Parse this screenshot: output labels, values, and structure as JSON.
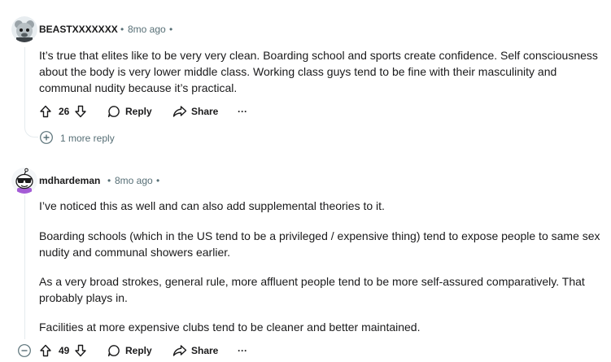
{
  "comments": [
    {
      "author": "BEASTXXXXXXX",
      "time": "8mo ago",
      "paragraphs": [
        "It’s true that elites like to be very very clean. Boarding school and sports create confidence. Self consciousness about the body is very lower middle class. Working class guys tend to be fine with their masculinity and communal nudity because it’s practical."
      ],
      "votes": "26",
      "reply_label": "Reply",
      "share_label": "Share",
      "more_label": "···",
      "more_replies": "1 more reply"
    },
    {
      "author": "mdhardeman",
      "time": "8mo ago",
      "paragraphs": [
        "I’ve noticed this as well and can also add supplemental theories to it.",
        "Boarding schools (which in the US tend to be a privileged / expensive thing) tend to expose people to same sex nudity and communal showers earlier.",
        "As a very broad strokes, general rule, more affluent people tend to be more self-assured comparatively. That probably plays in.",
        "Facilities at more expensive clubs tend to be cleaner and better maintained."
      ],
      "votes": "49",
      "reply_label": "Reply",
      "share_label": "Share",
      "more_label": "···"
    }
  ],
  "separator": "•",
  "icons": {
    "upvote": "upvote-arrow-icon",
    "downvote": "downvote-arrow-icon",
    "reply": "speech-bubble-icon",
    "share": "share-arrow-icon",
    "expand": "plus-circle-icon",
    "collapse": "minus-circle-icon"
  },
  "colors": {
    "text": "#1a1a1b",
    "meta": "#576f76",
    "thread_line": "#e5ebee"
  }
}
